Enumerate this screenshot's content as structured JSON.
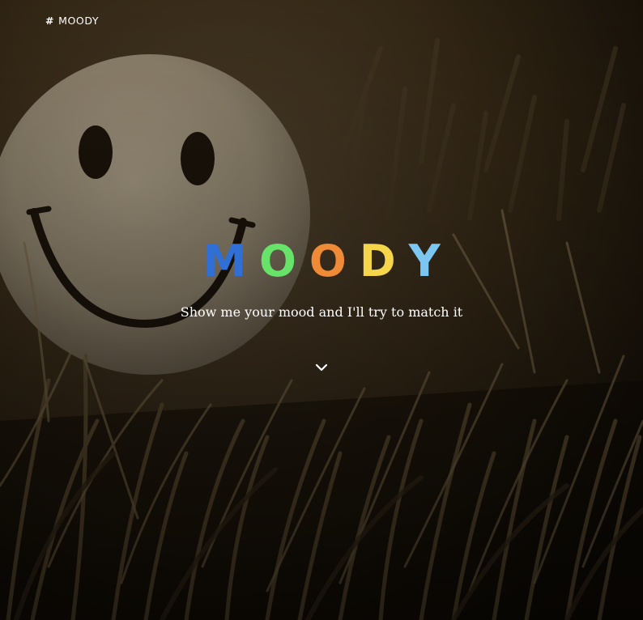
{
  "nav": {
    "brand_icon": "hash-icon",
    "brand_label": "MOODY"
  },
  "hero": {
    "title_letters": [
      {
        "char": "M",
        "color": "#2f6fd6"
      },
      {
        "char": "O",
        "color": "#67e36a"
      },
      {
        "char": "O",
        "color": "#ef8a37"
      },
      {
        "char": "D",
        "color": "#f5d54a"
      },
      {
        "char": "Y",
        "color": "#7cc7f2"
      }
    ],
    "subtitle": "Show me your mood and I'll try to match it",
    "scroll_icon": "chevron-down-icon"
  },
  "background": {
    "image": "sepia photo of a smiley-face ball in tall grass",
    "tint": "#3a2c17"
  }
}
